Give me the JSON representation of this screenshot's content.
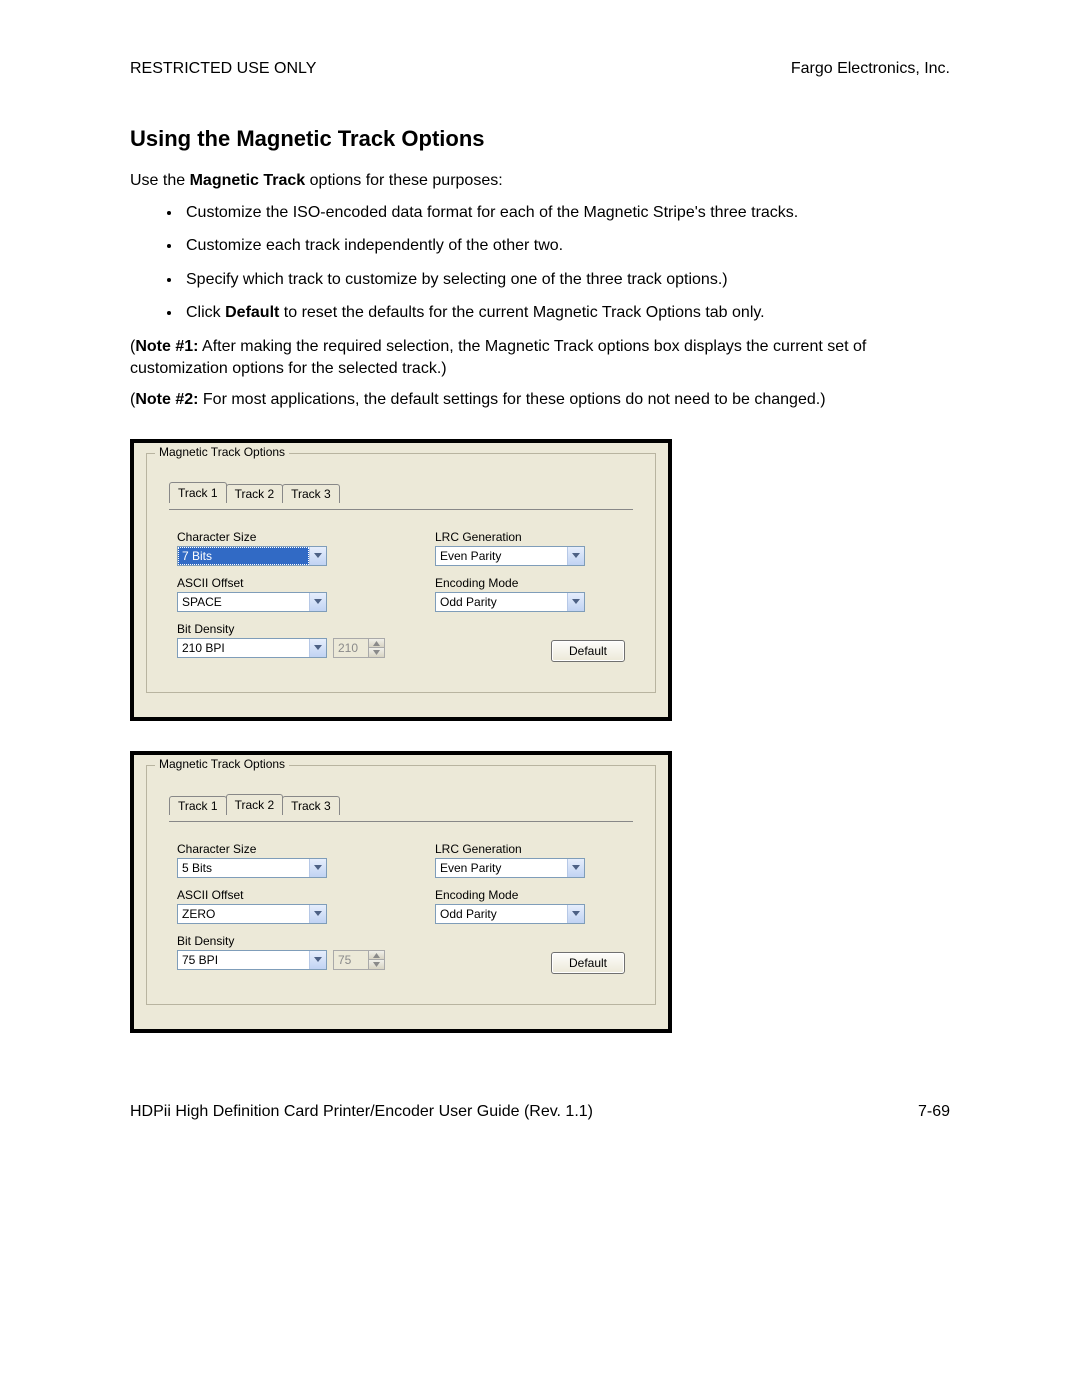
{
  "header": {
    "left": "RESTRICTED USE ONLY",
    "right": "Fargo Electronics, Inc."
  },
  "title": "Using the Magnetic Track Options",
  "intro_prefix": "Use the ",
  "intro_bold": "Magnetic Track",
  "intro_suffix": " options for these purposes:",
  "bullets": {
    "b1": "Customize the ISO-encoded data format for each of the Magnetic Stripe's three tracks.",
    "b2": "Customize each track independently of the other two.",
    "b3": "Specify which track to customize by selecting one of the three track options.)",
    "b4_prefix": "Click ",
    "b4_bold": "Default",
    "b4_suffix": " to reset the defaults for the current Magnetic Track Options tab only."
  },
  "note1_label": "Note #1:",
  "note1_text": "  After making the required selection, the Magnetic Track options box displays the current set of customization options for the selected track.)",
  "note2_label": "Note #2:",
  "note2_text": "  For most applications, the default settings for these options do not need to be changed.)",
  "panel": {
    "group_title": "Magnetic Track Options",
    "tabs": {
      "t1": "Track 1",
      "t2": "Track 2",
      "t3": "Track 3"
    },
    "labels": {
      "char_size": "Character Size",
      "ascii_offset": "ASCII Offset",
      "bit_density": "Bit Density",
      "lrc_gen": "LRC Generation",
      "enc_mode": "Encoding Mode"
    },
    "default_btn": "Default"
  },
  "shot1": {
    "char_size": "7 Bits",
    "ascii_offset": "SPACE",
    "bit_density": "210 BPI",
    "bpi_spin": "210",
    "lrc_gen": "Even Parity",
    "enc_mode": "Odd Parity"
  },
  "shot2": {
    "char_size": "5 Bits",
    "ascii_offset": "ZERO",
    "bit_density": "75 BPI",
    "bpi_spin": "75",
    "lrc_gen": "Even Parity",
    "enc_mode": "Odd Parity"
  },
  "footer": {
    "left": "HDPii High Definition Card Printer/Encoder User Guide (Rev. 1.1)",
    "right": "7-69"
  }
}
